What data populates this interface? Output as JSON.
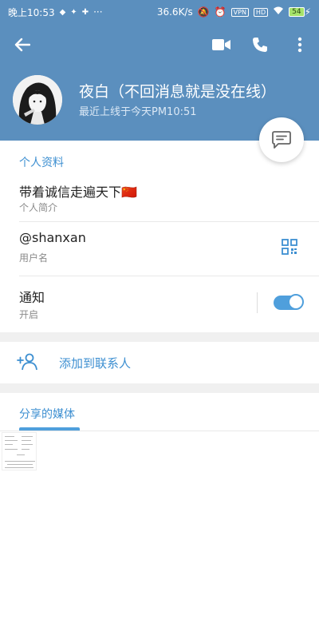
{
  "status_bar": {
    "time": "晚上10:53",
    "more": "···",
    "speed": "36.6K/s",
    "vpn": "VPN",
    "hd": "HD",
    "battery": "54"
  },
  "header": {
    "name": "夜白（不回消息就是没在线）",
    "last_seen": "最近上线于今天PM10:51"
  },
  "info": {
    "section_title": "个人资料",
    "bio": "带着诚信走遍天下🇨🇳",
    "bio_label": "个人简介",
    "username": "@shanxan",
    "username_label": "用户名",
    "notify": "通知",
    "notify_state": "开启",
    "notify_on": true
  },
  "actions": {
    "add_contact": "添加到联系人"
  },
  "media": {
    "title": "分享的媒体"
  },
  "colors": {
    "header_bg": "#5b8fbe",
    "accent": "#3d8fd1"
  }
}
